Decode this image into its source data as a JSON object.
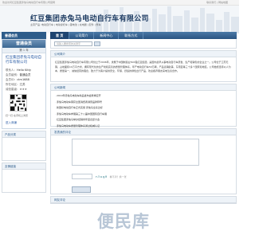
{
  "topbar": {
    "left_text": "欢迎访问红豆集团赤兔马电动自行车有限公司官网",
    "right_text": "联系我们 | 网站地图"
  },
  "header": {
    "company_name": "红豆集团赤兔马电动自行车有限公司",
    "subline": "主营产品: 电动自行车 | 电动摩托车 | 锂电池 | 充电器 | 配件 | 整车"
  },
  "sidebar": {
    "section_label": "普通会员",
    "member_title": "普通会员",
    "member_sub": "第 1 年",
    "member_name": "红豆集团赤兔马电动自行车有限公司",
    "rows": [
      {
        "label": "联系人：",
        "value": "Hello Kitty"
      },
      {
        "label": "会员级别：",
        "value": "普通会员"
      },
      {
        "label": "会员ID：",
        "value": "ctm1688"
      },
      {
        "label": "所在地区：",
        "value": "江苏"
      }
    ],
    "credit_label": "诚信星级：★★★",
    "qr_caption": "扫一扫 在手机上浏览",
    "enter_shop": "进入商铺",
    "product_box_title": "产品分类",
    "link_box_title": "友情链接"
  },
  "nav": {
    "items": [
      "首 页",
      "公司简介",
      "新闻中心",
      "联系方式"
    ]
  },
  "search": {
    "placeholder": "请输入要搜索的关键字"
  },
  "intro": {
    "title": "公司简介",
    "text": "红豆集团赤兔马电动自行车有限公司创立于2006年，隶属于中国制造业500强红豆集团，是国内最早从事电动自行车研发、生产和销售的企业之一。公司位于江苏无锡，占地面积10万平方米，拥有现代化的生产线和完善的质量管理体系，年产电动自行车50万辆，产品远销欧美、东南亚等三十多个国家和地区。公司始终坚持以人为本、质量第一、诚信经营的理念，致力于为客户提供安全、环保、舒适的绿色出行产品，欢迎各界朋友来电洽谈合作。"
  },
  "news": {
    "title": "公司新闻",
    "items": [
      "2019年赤兔马电动车新品发布会隆重召开",
      "赤兔马电动车荣获全国消费者满意品牌称号",
      "新国标电动自行车正式实施 赤兔马全系达标",
      "赤兔马电动车参展第三十八届中国国际自行车展",
      "红豆集团赤兔马举办经销商年度表彰大会",
      "赤兔马电动车质量管理体系通过权威认证"
    ]
  },
  "message": {
    "title": "发表我的评论",
    "captcha_text": "r3uq8",
    "captcha_tip": "看不清？换一张"
  },
  "comments": {
    "title": "网友评论"
  },
  "watermark": "便民库",
  "colors": {
    "brand_blue": "#2d5c8a",
    "company_title": "#1f3d63",
    "link_blue": "#2558a3"
  }
}
